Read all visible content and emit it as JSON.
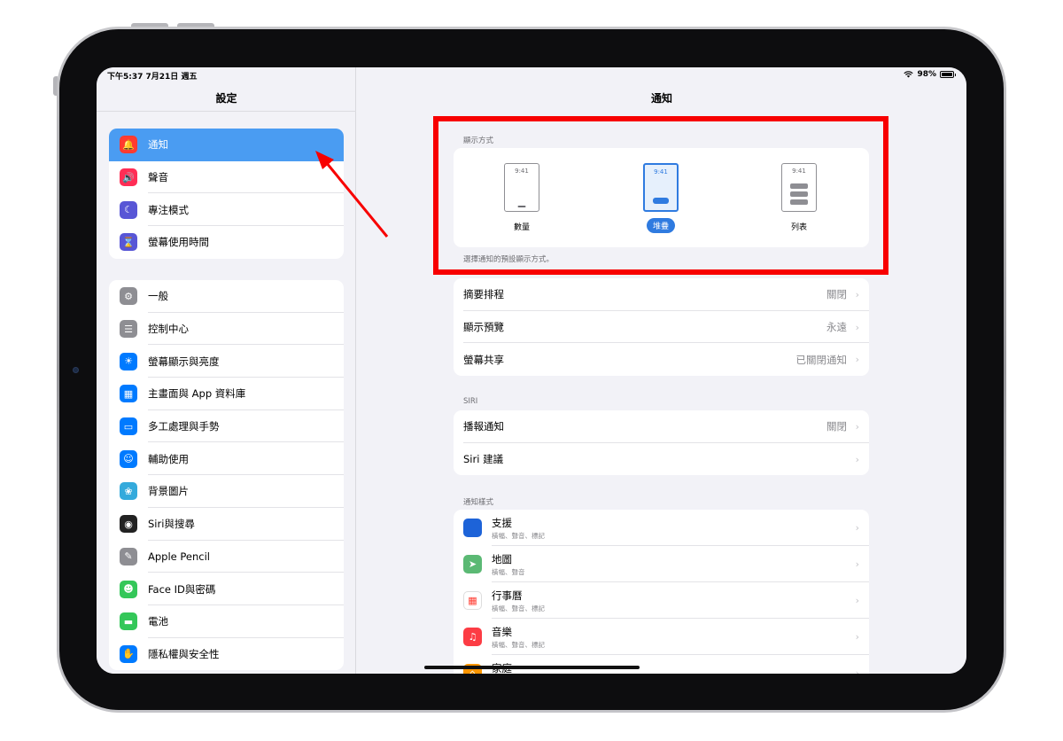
{
  "status_bar": {
    "time_date": "下午5:37  7月21日 週五",
    "battery": "98%"
  },
  "sidebar": {
    "title": "設定",
    "group1": [
      {
        "label": "通知",
        "icon": "bell-icon",
        "color": "#ff3b30",
        "glyph": "🔔",
        "selected": true
      },
      {
        "label": "聲音",
        "icon": "speaker-icon",
        "color": "#ff2d55",
        "glyph": "🔊"
      },
      {
        "label": "專注模式",
        "icon": "moon-icon",
        "color": "#5856d6",
        "glyph": "☾"
      },
      {
        "label": "螢幕使用時間",
        "icon": "hourglass-icon",
        "color": "#5856d6",
        "glyph": "⌛"
      }
    ],
    "group2": [
      {
        "label": "一般",
        "icon": "gear-icon",
        "color": "#8e8e93",
        "glyph": "⚙"
      },
      {
        "label": "控制中心",
        "icon": "toggles-icon",
        "color": "#8e8e93",
        "glyph": "☰"
      },
      {
        "label": "螢幕顯示與亮度",
        "icon": "sun-icon",
        "color": "#007aff",
        "glyph": "☀"
      },
      {
        "label": "主畫面與 App 資料庫",
        "icon": "home-screen-icon",
        "color": "#007aff",
        "glyph": "▦"
      },
      {
        "label": "多工處理與手勢",
        "icon": "multitask-icon",
        "color": "#007aff",
        "glyph": "▭"
      },
      {
        "label": "輔助使用",
        "icon": "accessibility-icon",
        "color": "#007aff",
        "glyph": "☺"
      },
      {
        "label": "背景圖片",
        "icon": "flower-icon",
        "color": "#34aadc",
        "glyph": "❀"
      },
      {
        "label": "Siri與搜尋",
        "icon": "siri-icon",
        "color": "#222222",
        "glyph": "◉"
      },
      {
        "label": "Apple Pencil",
        "icon": "pencil-icon",
        "color": "#8e8e93",
        "glyph": "✎"
      },
      {
        "label": "Face ID與密碼",
        "icon": "faceid-icon",
        "color": "#34c759",
        "glyph": "☻"
      },
      {
        "label": "電池",
        "icon": "battery-icon",
        "color": "#34c759",
        "glyph": "▬"
      },
      {
        "label": "隱私權與安全性",
        "icon": "hand-icon",
        "color": "#007aff",
        "glyph": "✋"
      }
    ]
  },
  "detail": {
    "title": "通知",
    "display_style": {
      "header": "顯示方式",
      "options": [
        {
          "label": "數量",
          "time": "9:41"
        },
        {
          "label": "堆疊",
          "time": "9:41",
          "selected": true
        },
        {
          "label": "列表",
          "time": "9:41"
        }
      ],
      "footer": "選擇通知的預設顯示方式。"
    },
    "rows1": [
      {
        "label": "摘要排程",
        "value": "關閉"
      },
      {
        "label": "顯示預覽",
        "value": "永遠"
      },
      {
        "label": "螢幕共享",
        "value": "已關閉通知"
      }
    ],
    "siri": {
      "header": "SIRI",
      "rows": [
        {
          "label": "播報通知",
          "value": "關閉"
        },
        {
          "label": "Siri 建議",
          "value": ""
        }
      ]
    },
    "notification_style": {
      "header": "通知樣式",
      "apps": [
        {
          "name": "支援",
          "sub": "橫幅、聲音、標記",
          "icon": "apple-support-icon",
          "color": "#1d63d8",
          "glyph": ""
        },
        {
          "name": "地圖",
          "sub": "橫幅、聲音",
          "icon": "maps-icon",
          "color": "#5bb974",
          "glyph": "➤"
        },
        {
          "name": "行事曆",
          "sub": "橫幅、聲音、標記",
          "icon": "calendar-icon",
          "color": "#ffffff",
          "glyph": "▦"
        },
        {
          "name": "音樂",
          "sub": "橫幅、聲音、標記",
          "icon": "music-icon",
          "color": "#fc3c44",
          "glyph": "♫"
        },
        {
          "name": "家庭",
          "sub": "",
          "icon": "home-icon",
          "color": "#ff9500",
          "glyph": "⌂"
        }
      ]
    }
  },
  "annotation": {
    "box_color": "#f80000",
    "arrow_color": "#f80000"
  }
}
